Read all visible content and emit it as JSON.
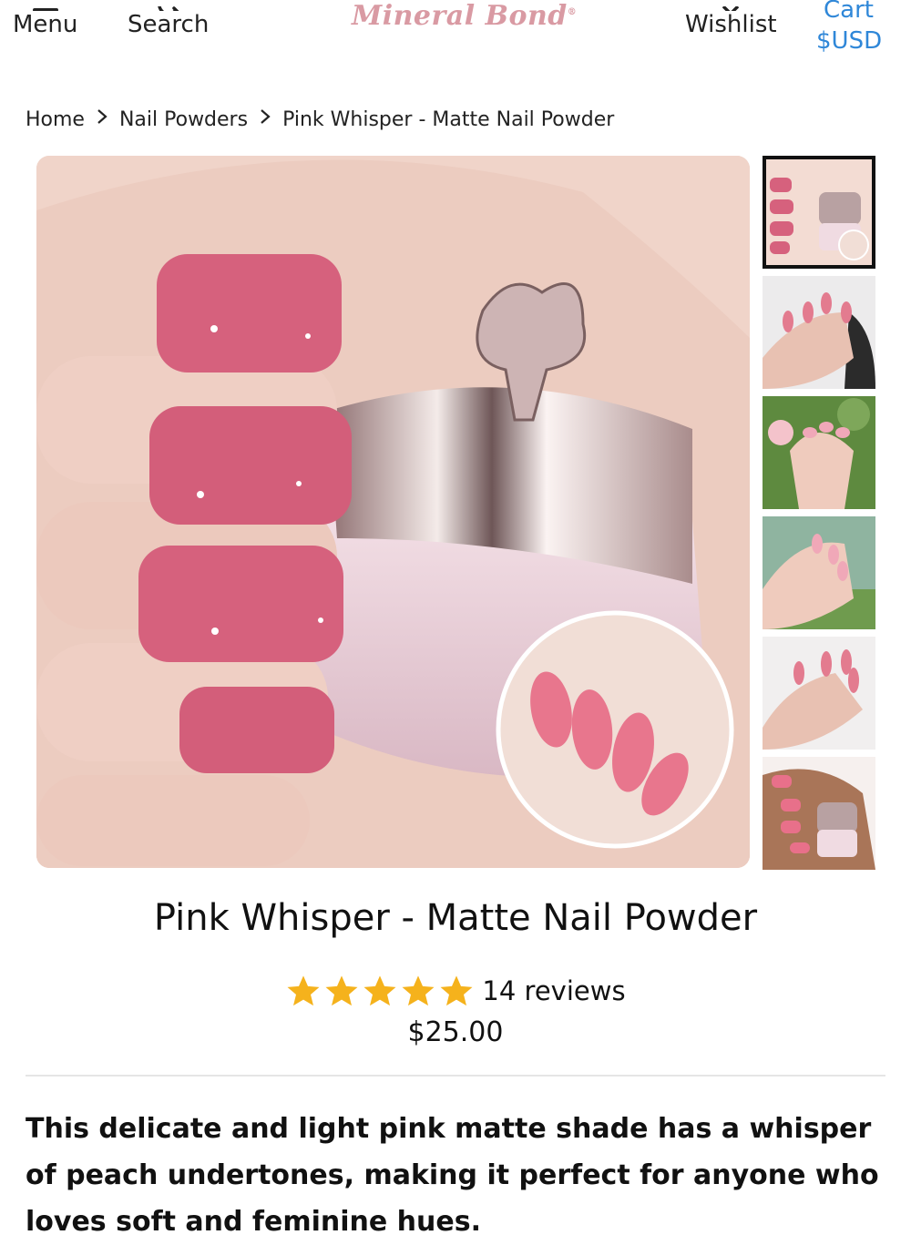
{
  "header": {
    "menu_label": "Menu",
    "search_label": "Search",
    "logo_text": "Mineral Bond",
    "wishlist_label": "Wishlist",
    "cart_label": "Cart",
    "currency_label": "$USD"
  },
  "breadcrumb": {
    "items": [
      "Home",
      "Nail Powders",
      "Pink Whisper - Matte Nail Powder"
    ],
    "separator": ">"
  },
  "gallery": {
    "main_image": "pink-nails-holding-powder-jar",
    "thumbnails": [
      {
        "name": "thumb-jar-hand",
        "active": true
      },
      {
        "name": "thumb-almond-nails-marble",
        "active": false
      },
      {
        "name": "thumb-hand-flowers",
        "active": false
      },
      {
        "name": "thumb-hand-grass",
        "active": false
      },
      {
        "name": "thumb-almond-nails-ring",
        "active": false
      },
      {
        "name": "thumb-hand-holding-jar",
        "active": false
      }
    ]
  },
  "product": {
    "title": "Pink Whisper - Matte Nail Powder",
    "rating": 5,
    "reviews_label": "14 reviews",
    "price": "$25.00",
    "description": "This delicate and light pink matte shade has a whisper of peach undertones, making it perfect for anyone who loves soft and feminine hues."
  },
  "colors": {
    "accent": "#2f87d8",
    "star": "#f5b21c",
    "logo": "#d99aa3",
    "nail_pink": "#d6617d"
  }
}
